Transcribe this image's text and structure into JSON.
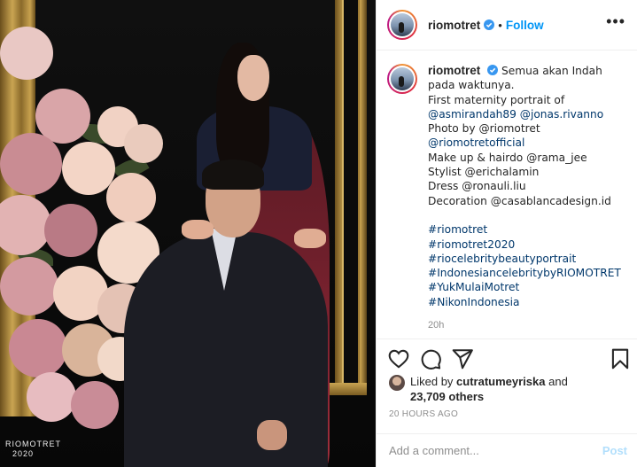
{
  "header": {
    "username": "riomotret",
    "separator": "•",
    "follow_label": "Follow",
    "more_label": "•••"
  },
  "caption": {
    "username": "riomotret",
    "lines": [
      "Semua akan Indah",
      "pada waktunya.",
      "First maternity portrait of",
      "@asmirandah89 @jonas.rivanno",
      "Photo by @riomotret",
      "@riomotretofficial",
      "Make up & hairdo @rama_jee",
      "Stylist @erichalamin",
      "Dress @ronauli.liu",
      "Decoration @casablancadesign.id",
      "",
      "#riomotret",
      "#riomotret2020",
      "#riocelebritybeautyportrait",
      "#IndonesiancelebritybyRIOMOTRET",
      "#YukMulaiMotret",
      "#NikonIndonesia"
    ],
    "time": "20h"
  },
  "likes": {
    "prefix": "Liked by",
    "user": "cutratumeyriska",
    "and": "and",
    "count": "23,709 others"
  },
  "post_age": "20 HOURS AGO",
  "comment_box": {
    "placeholder": "Add a comment...",
    "post_label": "Post"
  },
  "photo": {
    "watermark_line1": "RIOMOTRET",
    "watermark_line2": "2020"
  },
  "colors": {
    "accent": "#0095f6",
    "post_disabled": "#b2dffc",
    "link": "#00376b",
    "muted": "#8e8e8e"
  },
  "icons": [
    "heart-icon",
    "comment-icon",
    "share-icon",
    "bookmark-icon",
    "verified-badge-icon",
    "more-icon"
  ]
}
